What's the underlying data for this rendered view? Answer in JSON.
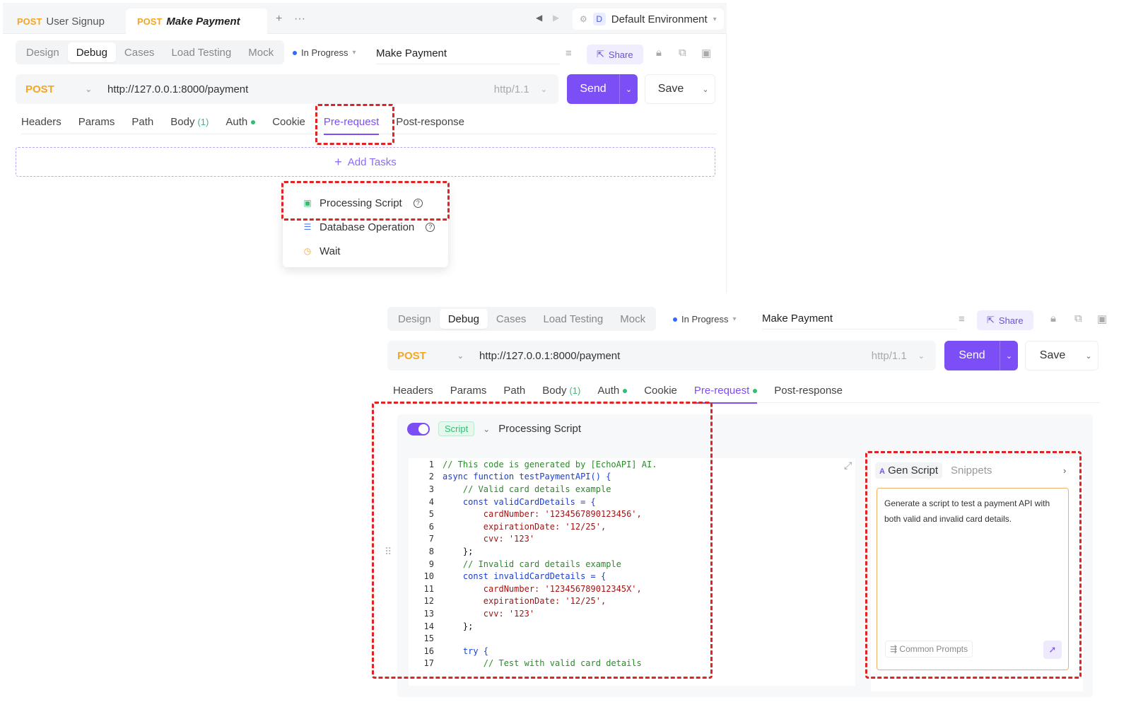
{
  "top": {
    "request_tabs": [
      {
        "method": "POST",
        "name": "User Signup"
      },
      {
        "method": "POST",
        "name": "Make Payment"
      }
    ],
    "new_tab_icon": "plus-icon",
    "more_icon": "more-icon",
    "environment": {
      "letter": "D",
      "name": "Default Environment"
    },
    "modes": [
      "Design",
      "Debug",
      "Cases",
      "Load Testing",
      "Mock"
    ],
    "active_mode": "Debug",
    "status": "In Progress",
    "api_name": "Make Payment",
    "share_label": "Share",
    "request": {
      "method": "POST",
      "url": "http://127.0.0.1:8000/payment",
      "protocol": "http/1.1"
    },
    "send_label": "Send",
    "save_label": "Save",
    "sub_tabs": {
      "headers": "Headers",
      "params": "Params",
      "path": "Path",
      "body": "Body",
      "body_count": "(1)",
      "auth": "Auth",
      "cookie": "Cookie",
      "pre_request": "Pre-request",
      "post_response": "Post-response"
    },
    "add_tasks_label": "Add Tasks",
    "task_menu": [
      {
        "label": "Processing Script",
        "icon": "script-icon",
        "color": "#2fbf71"
      },
      {
        "label": "Database Operation",
        "icon": "database-icon",
        "color": "#4a7bf5"
      },
      {
        "label": "Wait",
        "icon": "clock-icon",
        "color": "#f5a623"
      }
    ]
  },
  "bottom": {
    "modes": [
      "Design",
      "Debug",
      "Cases",
      "Load Testing",
      "Mock"
    ],
    "active_mode": "Debug",
    "status": "In Progress",
    "api_name": "Make Payment",
    "share_label": "Share",
    "request": {
      "method": "POST",
      "url": "http://127.0.0.1:8000/payment",
      "protocol": "http/1.1"
    },
    "send_label": "Send",
    "save_label": "Save",
    "sub_tabs": {
      "headers": "Headers",
      "params": "Params",
      "path": "Path",
      "body": "Body",
      "body_count": "(1)",
      "auth": "Auth",
      "cookie": "Cookie",
      "pre_request": "Pre-request",
      "post_response": "Post-response"
    },
    "script_badge": "Script",
    "script_title": "Processing Script",
    "code_lines": [
      "// This code is generated by [EchoAPI] AI.",
      "async function testPaymentAPI() {",
      "    // Valid card details example",
      "    const validCardDetails = {",
      "        cardNumber: '1234567890123456',",
      "        expirationDate: '12/25',",
      "        cvv: '123'",
      "    };",
      "    // Invalid card details example",
      "    const invalidCardDetails = {",
      "        cardNumber: '123456789012345X',",
      "        expirationDate: '12/25',",
      "        cvv: '123'",
      "    };",
      "",
      "    try {",
      "        // Test with valid card details"
    ],
    "ai": {
      "gen_tab": "Gen Script",
      "snippets_tab": "Snippets",
      "prompt_text": "Generate a script to test a payment API with both valid and invalid card details.",
      "common_prompts": "Common Prompts"
    }
  },
  "colors": {
    "accent": "#7b4ff5",
    "post": "#f5a623",
    "highlight": "#e02323",
    "ok": "#2fbf71"
  }
}
